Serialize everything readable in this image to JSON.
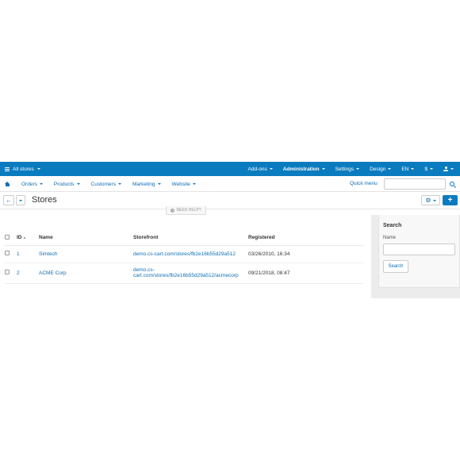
{
  "topbar": {
    "store_selector": "All stores",
    "items": [
      {
        "label": "Add-ons",
        "bold": false
      },
      {
        "label": "Administration",
        "bold": true
      },
      {
        "label": "Settings",
        "bold": false
      },
      {
        "label": "Design",
        "bold": false
      },
      {
        "label": "EN",
        "bold": false
      },
      {
        "label": "$",
        "bold": false
      }
    ]
  },
  "navbar": {
    "items": [
      "Orders",
      "Products",
      "Customers",
      "Marketing",
      "Website"
    ],
    "quick_menu": "Quick menu",
    "search_placeholder": ""
  },
  "titlebar": {
    "title": "Stores",
    "need_help": "NEED HELP?",
    "add_label": "+"
  },
  "table": {
    "columns": {
      "id": "ID",
      "name": "Name",
      "storefront": "Storefront",
      "registered": "Registered"
    },
    "rows": [
      {
        "id": "1",
        "name": "Simtech",
        "storefront": "demo.cs-cart.com/stores/fb2e16b55d29a512",
        "registered": "03/26/2010, 16:34"
      },
      {
        "id": "2",
        "name": "ACME Corp",
        "storefront_line1": "demo.cs-",
        "storefront_line2": "cart.com/stores/fb2e16b55d29a512/acmecorp",
        "registered": "09/21/2018, 08:47"
      }
    ]
  },
  "search_panel": {
    "title": "Search",
    "name_label": "Name",
    "name_value": "",
    "button_label": "Search"
  },
  "colors": {
    "topbar": "#0b7bbf",
    "link": "#0b6eb4"
  }
}
